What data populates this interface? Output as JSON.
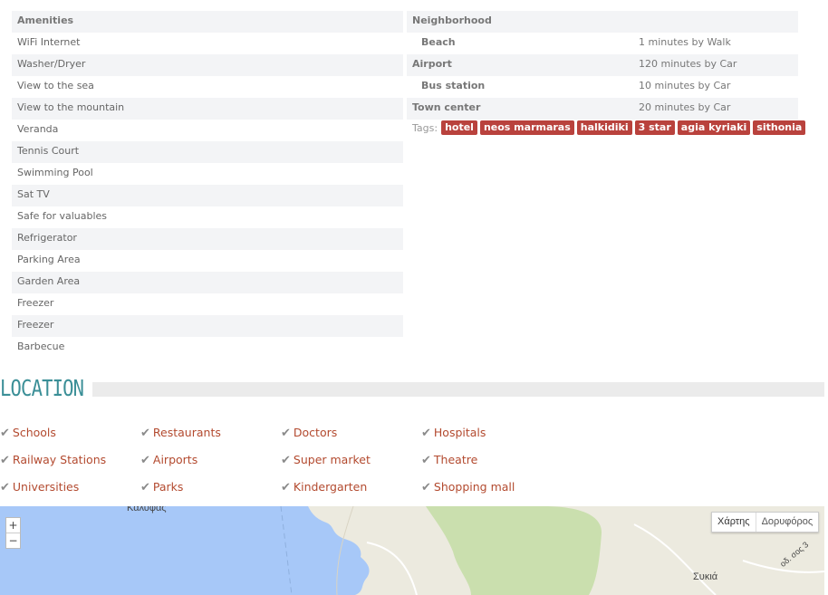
{
  "amenities": {
    "header": "Amenities",
    "items": [
      "WiFi Internet",
      "Washer/Dryer",
      "View to the sea",
      "View to the mountain",
      "Veranda",
      "Tennis Court",
      "Swimming Pool",
      "Sat TV",
      "Safe for valuables",
      "Refrigerator",
      "Parking Area",
      "Garden Area",
      "Freezer",
      "Freezer",
      "Barbecue"
    ]
  },
  "neighborhood": {
    "header": "Neighborhood",
    "rows": [
      {
        "name": "Beach",
        "distance": "1 minutes by  Walk"
      },
      {
        "name": "Airport",
        "distance": "120 minutes by  Car"
      },
      {
        "name": "Bus station",
        "distance": "10 minutes by  Car"
      },
      {
        "name": "Town center",
        "distance": "20 minutes by  Car"
      }
    ]
  },
  "tags": {
    "label": "Tags:",
    "items": [
      "hotel",
      "neos marmaras",
      "halkidiki",
      "3 star",
      "agia kyriaki",
      "sithonia"
    ]
  },
  "location": {
    "title": "LOCATION",
    "pois": [
      "Schools",
      "Restaurants",
      "Doctors",
      "Hospitals",
      "Railway Stations",
      "Airports",
      "Super market",
      "Theatre",
      "Universities",
      "Parks",
      "Kindergarten",
      "Shopping mall"
    ]
  },
  "map": {
    "zoom_in": "+",
    "zoom_out": "−",
    "type_map": "Χάρτης",
    "type_satellite": "Δορυφόρος",
    "label_town": "Συκιά",
    "label_top": "Καλυφας",
    "label_road": "οδ. σος 3"
  },
  "colors": {
    "accent": "#3b8f97",
    "tag": "#b9423d",
    "poi": "#b34a2f"
  },
  "icons": {
    "check": "check-icon"
  }
}
